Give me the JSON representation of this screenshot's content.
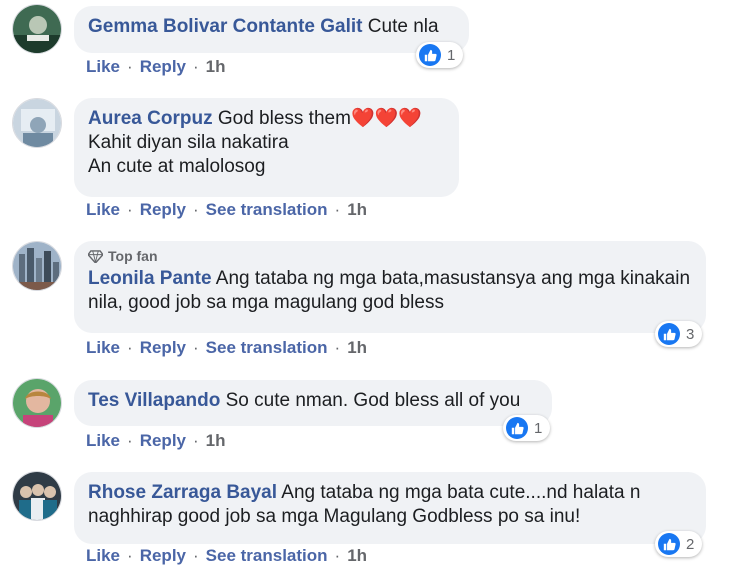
{
  "colors": {
    "bubble_bg": "#f0f2f5",
    "author": "#385898",
    "link": "#4b66a7",
    "meta": "#65676b",
    "like_blue": "#1877f2"
  },
  "labels": {
    "like": "Like",
    "reply": "Reply",
    "see_translation": "See translation",
    "top_fan": "Top fan"
  },
  "comments": [
    {
      "author": "Gemma Bolivar Contante Galit",
      "text": "Cute nla",
      "time": "1h",
      "reactions": "1",
      "reaction_icon": "like-icon"
    },
    {
      "author": "Aurea Corpuz",
      "text": "God bless them",
      "emoji": "❤️❤️❤️",
      "extra_text": "Kahit diyan sila nakatira\nAn cute at malolosog",
      "time": "1h",
      "has_translation": true
    },
    {
      "author": "Leonila Pante",
      "badge": "Top fan",
      "text": "Ang tataba ng mga bata,masustansya ang mga kinakain nila, good job sa mga magulang god bless",
      "time": "1h",
      "reactions": "3",
      "reaction_icon": "like-icon",
      "has_translation": true
    },
    {
      "author": "Tes Villapando",
      "text": "So cute nman. God bless all of you",
      "time": "1h",
      "reactions": "1",
      "reaction_icon": "like-icon"
    },
    {
      "author": "Rhose Zarraga Bayal",
      "text": "Ang tataba ng mga bata cute....nd halata n naghhirap good job sa mga Magulang Godbless po sa inu!",
      "time": "1h",
      "reactions": "2",
      "reaction_icon": "like-icon",
      "has_translation": true
    }
  ]
}
